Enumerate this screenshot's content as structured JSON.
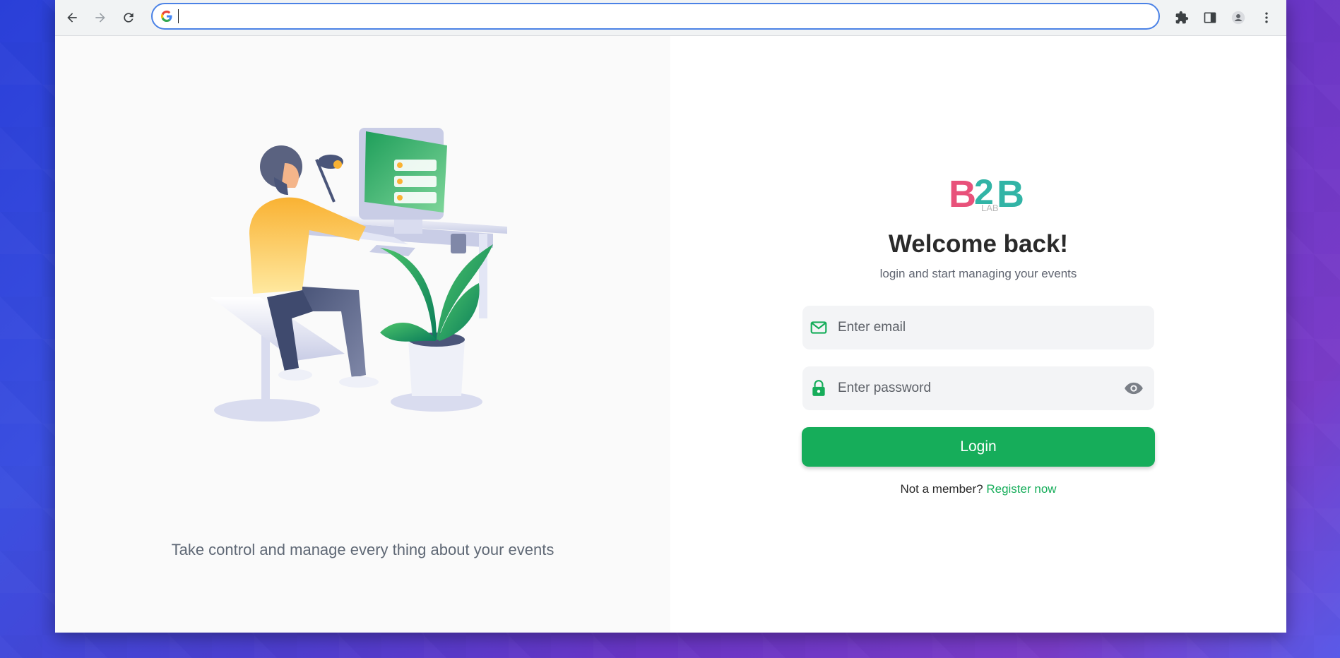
{
  "browser": {
    "omnibox_value": "",
    "icons": {
      "back": "arrow-left-icon",
      "forward": "arrow-right-icon",
      "reload": "reload-icon",
      "google": "google-g-icon",
      "extensions": "puzzle-icon",
      "side_panel": "side-panel-icon",
      "profile": "profile-icon",
      "menu": "kebab-menu-icon"
    }
  },
  "left_panel": {
    "tagline": "Take control and manage every thing about your events"
  },
  "login": {
    "logo_main": "B2B",
    "logo_sub": "LAB",
    "title": "Welcome back!",
    "subtitle": "login and start managing your events",
    "email_placeholder": "Enter email",
    "password_placeholder": "Enter password",
    "login_label": "Login",
    "not_member": "Not a member?",
    "register_label": "Register now"
  },
  "colors": {
    "accent": "#16ad5a",
    "logo_pink": "#e8517a",
    "logo_teal": "#32b4a6"
  }
}
